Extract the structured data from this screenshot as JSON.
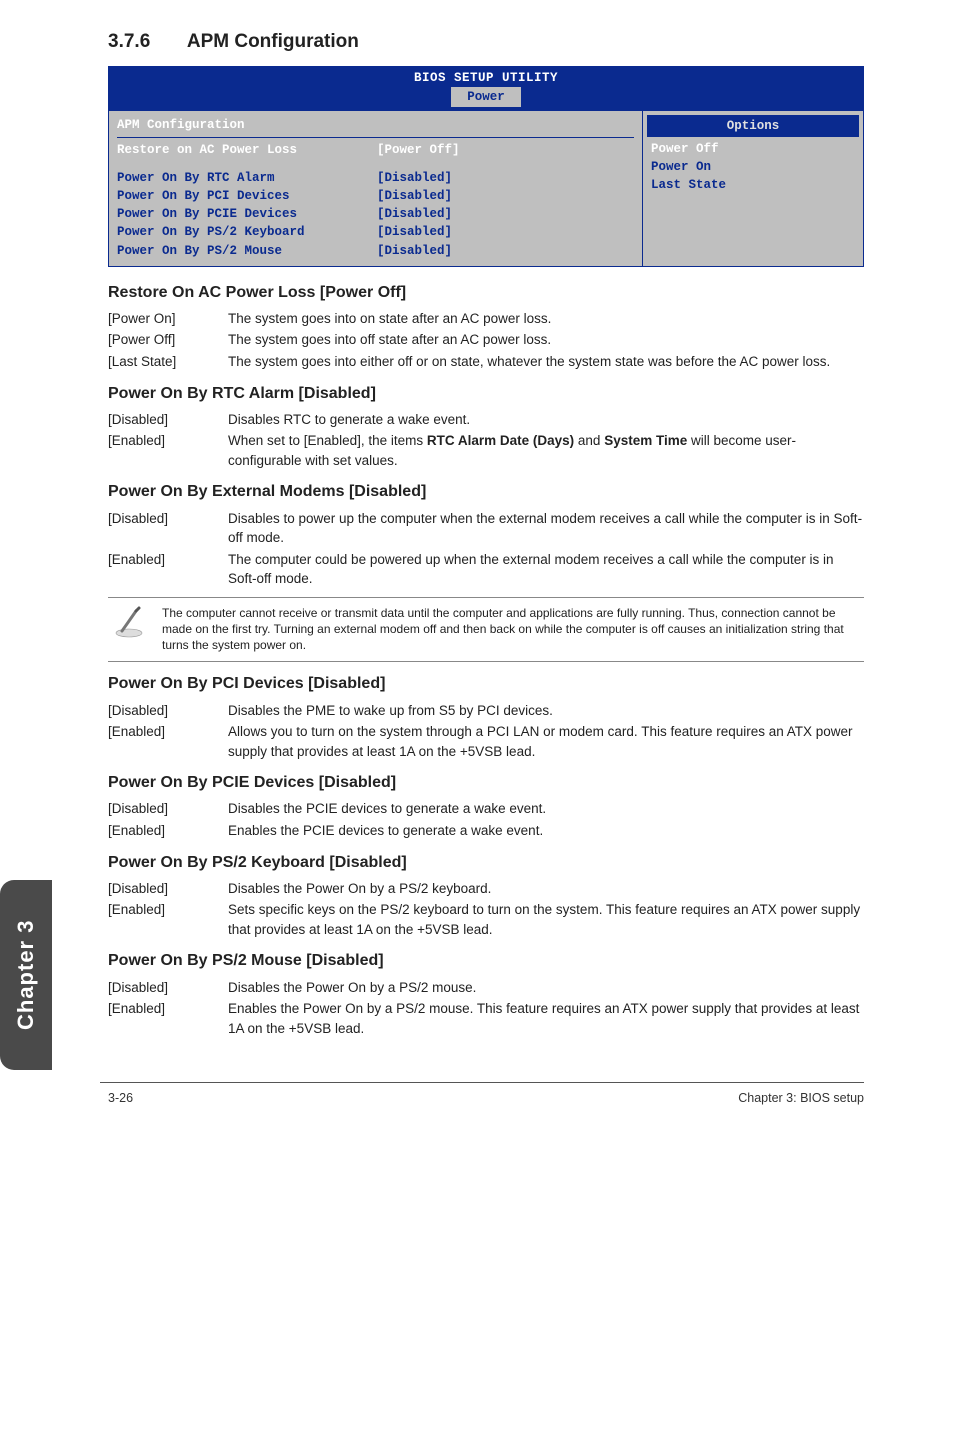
{
  "section": {
    "number": "3.7.6",
    "title": "APM Configuration"
  },
  "bios": {
    "utility_title": "BIOS SETUP UTILITY",
    "tab": "Power",
    "panel_title": "APM Configuration",
    "rows": [
      {
        "key": "Restore on AC Power Loss",
        "val": "[Power Off]"
      },
      {
        "key": "Power On By RTC Alarm",
        "val": "[Disabled]"
      },
      {
        "key": "Power On By PCI Devices",
        "val": "[Disabled]"
      },
      {
        "key": "Power On By PCIE Devices",
        "val": "[Disabled]"
      },
      {
        "key": "Power On By PS/2 Keyboard",
        "val": "[Disabled]"
      },
      {
        "key": "Power On By PS/2 Mouse",
        "val": "[Disabled]"
      }
    ],
    "options": {
      "title": "Options",
      "items": [
        "Power Off",
        "Power On",
        "Last State"
      ]
    }
  },
  "subsections": [
    {
      "title": "Restore On AC Power Loss [Power Off]",
      "items": [
        {
          "k": "[Power On]",
          "v": "The system goes into on state after an AC power loss."
        },
        {
          "k": "[Power Off]",
          "v": "The system goes into off state after an AC power loss."
        },
        {
          "k": "[Last State]",
          "v": "The system goes into either off or on state, whatever the system state was before the AC power loss."
        }
      ]
    },
    {
      "title": "Power On By RTC Alarm [Disabled]",
      "items": [
        {
          "k": "[Disabled]",
          "v": "Disables RTC to generate a wake event."
        },
        {
          "k": "[Enabled]",
          "v_html": "When set to [Enabled], the items <b>RTC Alarm Date (Days)</b> and <b>System Time</b> will become user-configurable with set values."
        }
      ]
    },
    {
      "title": "Power On By External Modems [Disabled]",
      "items": [
        {
          "k": "[Disabled]",
          "v": "Disables to power up the computer when the external modem receives a call while the computer is in Soft-off mode."
        },
        {
          "k": "[Enabled]",
          "v": "The computer could be powered up when the external modem receives a call while the computer is in Soft-off mode."
        }
      ]
    }
  ],
  "note": "The computer cannot receive or transmit data until the computer and applications are fully running. Thus, connection cannot be made on the first try. Turning an external modem off and then back on while the computer is off causes an initialization string that turns the system power on.",
  "subsections2": [
    {
      "title": "Power On By PCI Devices [Disabled]",
      "items": [
        {
          "k": "[Disabled]",
          "v": "Disables the PME to wake up from S5 by PCI devices."
        },
        {
          "k": "[Enabled]",
          "v": "Allows you to turn on the system through a PCI LAN or modem card. This feature requires an ATX power supply that provides at least 1A on the +5VSB lead."
        }
      ]
    },
    {
      "title": "Power On By PCIE Devices [Disabled]",
      "items": [
        {
          "k": "[Disabled]",
          "v": "Disables the PCIE devices to generate a wake event."
        },
        {
          "k": "[Enabled]",
          "v": "Enables the PCIE devices to generate a wake event."
        }
      ]
    },
    {
      "title": "Power On By PS/2 Keyboard [Disabled]",
      "items": [
        {
          "k": "[Disabled]",
          "v": "Disables the Power On by a PS/2 keyboard."
        },
        {
          "k": "[Enabled]",
          "v": "Sets specific keys on the PS/2 keyboard to turn on the system. This feature requires an ATX power supply that provides at least 1A on the +5VSB lead."
        }
      ]
    },
    {
      "title": "Power On By PS/2 Mouse [Disabled]",
      "items": [
        {
          "k": "[Disabled]",
          "v": "Disables the Power On by a PS/2 mouse."
        },
        {
          "k": "[Enabled]",
          "v": "Enables the Power On by a PS/2 mouse. This feature requires an ATX power supply that provides at least 1A on the +5VSB lead."
        }
      ]
    }
  ],
  "sidetab": "Chapter 3",
  "footer": {
    "left": "3-26",
    "right": "Chapter 3: BIOS setup"
  }
}
